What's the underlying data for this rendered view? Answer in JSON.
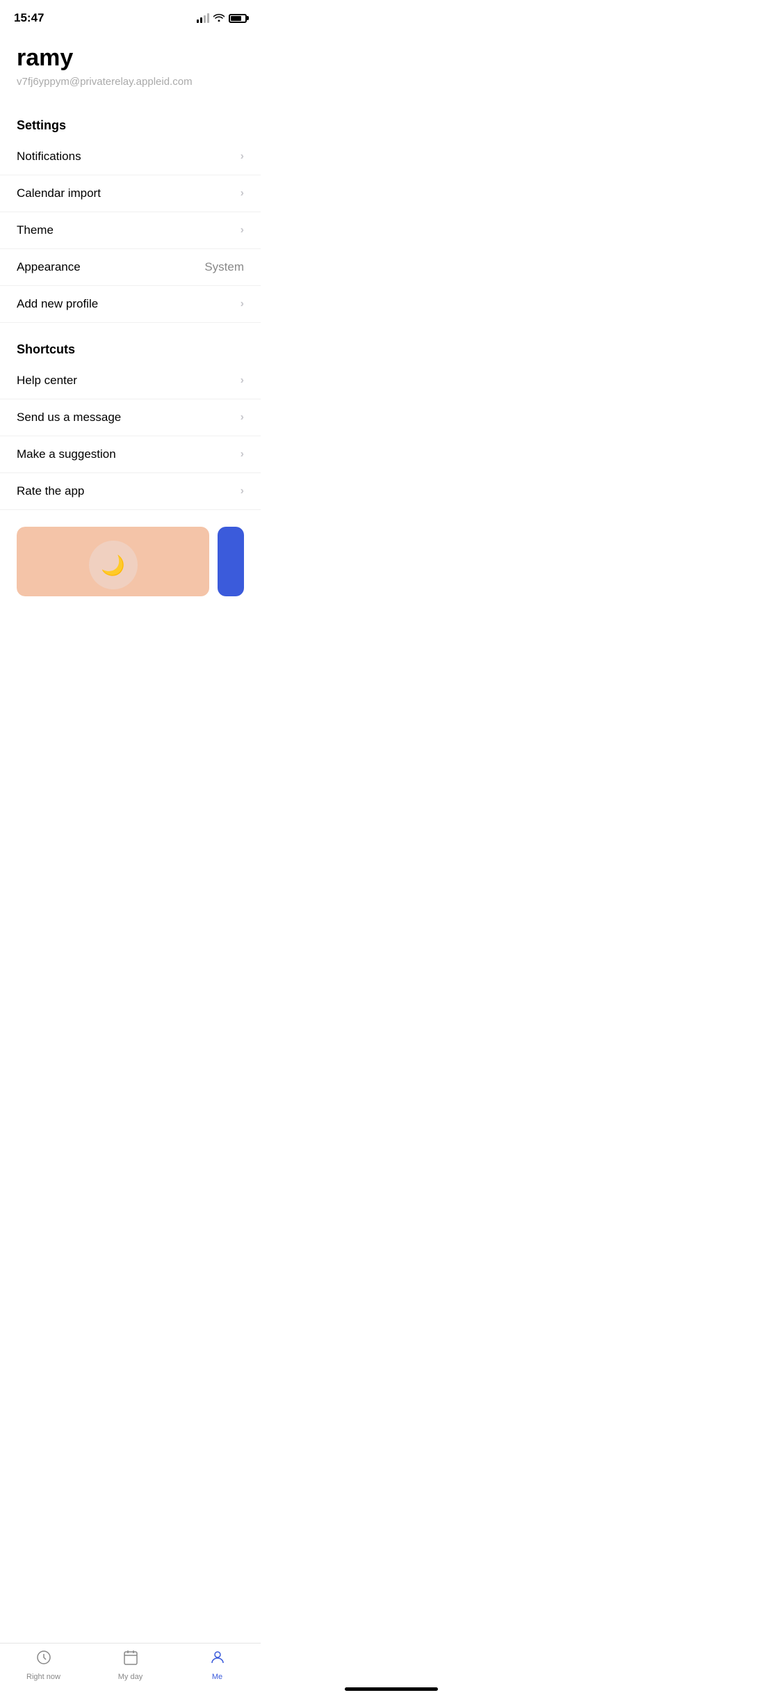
{
  "statusBar": {
    "time": "15:47"
  },
  "profile": {
    "name": "ramy",
    "email": "v7fj6yppym@privaterelay.appleid.com"
  },
  "settings": {
    "sectionHeader": "Settings",
    "items": [
      {
        "label": "Notifications",
        "value": "",
        "hasChevron": true
      },
      {
        "label": "Calendar import",
        "value": "",
        "hasChevron": true
      },
      {
        "label": "Theme",
        "value": "",
        "hasChevron": true
      },
      {
        "label": "Appearance",
        "value": "System",
        "hasChevron": false
      },
      {
        "label": "Add new profile",
        "value": "",
        "hasChevron": true
      }
    ]
  },
  "shortcuts": {
    "sectionHeader": "Shortcuts",
    "items": [
      {
        "label": "Help center",
        "hasChevron": true
      },
      {
        "label": "Send us a message",
        "hasChevron": true
      },
      {
        "label": "Make a suggestion",
        "hasChevron": true
      },
      {
        "label": "Rate the app",
        "hasChevron": true
      }
    ]
  },
  "tabBar": {
    "tabs": [
      {
        "id": "right-now",
        "label": "Right now",
        "active": false
      },
      {
        "id": "my-day",
        "label": "My day",
        "active": false
      },
      {
        "id": "me",
        "label": "Me",
        "active": true
      }
    ]
  }
}
